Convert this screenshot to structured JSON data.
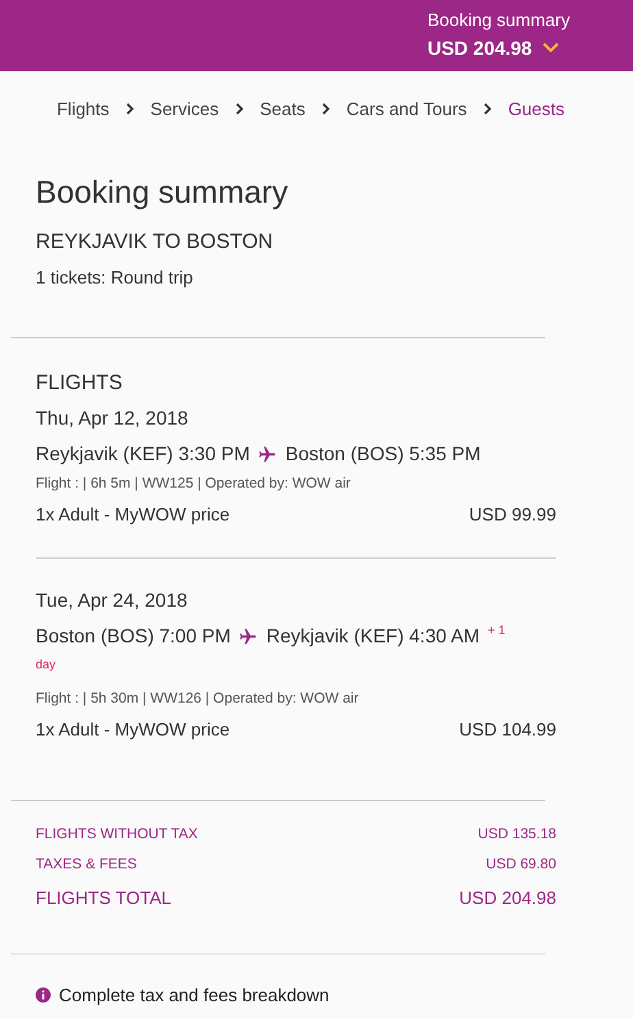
{
  "header": {
    "label": "Booking summary",
    "total": "USD 204.98"
  },
  "breadcrumb": [
    {
      "label": "Flights",
      "selected": false
    },
    {
      "label": "Services",
      "selected": false
    },
    {
      "label": "Seats",
      "selected": false
    },
    {
      "label": "Cars and Tours",
      "selected": false
    },
    {
      "label": "Guests",
      "selected": true
    }
  ],
  "title": "Booking summary",
  "route": "REYKJAVIK TO BOSTON",
  "tickets": "1 tickets: Round trip",
  "flights": {
    "heading": "FLIGHTS",
    "segments": [
      {
        "date": "Thu, Apr 12, 2018",
        "origin": "Reykjavik (KEF) 3:30 PM",
        "destination": "Boston (BOS) 5:35 PM",
        "details": "Flight : | 6h 5m | WW125 | Operated by: WOW air",
        "fare": "1x Adult - MyWOW price",
        "price": "USD 99.99"
      },
      {
        "date": "Tue, Apr 24, 2018",
        "origin": "Boston (BOS) 7:00 PM",
        "destination": "Reykjavik (KEF) 4:30 AM",
        "day_offset": "+ 1",
        "day_offset_unit": "day",
        "details": "Flight : | 5h 30m | WW126 | Operated by: WOW air",
        "fare": "1x Adult - MyWOW price",
        "price": "USD 104.99"
      }
    ]
  },
  "totals": [
    {
      "kind": "line",
      "label": "FLIGHTS WITHOUT TAX",
      "value": "USD 135.18"
    },
    {
      "kind": "line",
      "label": "TAXES & FEES",
      "value": "USD 69.80"
    },
    {
      "kind": "total",
      "label": "FLIGHTS TOTAL",
      "value": "USD 204.98"
    }
  ],
  "breakdown_link": "Complete tax and fees breakdown"
}
